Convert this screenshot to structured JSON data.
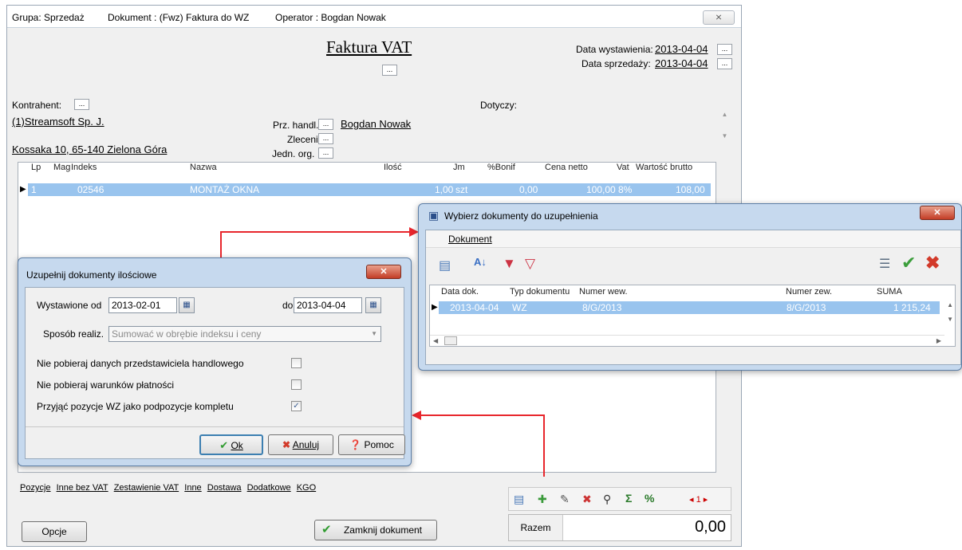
{
  "main": {
    "title_group": "Grupa: Sprzedaż",
    "title_doc": "Dokument : (Fwz) Faktura do WZ",
    "title_operator": "Operator : Bogdan Nowak",
    "close_label": "⨯",
    "heading": "Faktura VAT",
    "dots": "...",
    "data_wyst_label": "Data wystawienia:",
    "data_wyst": "2013-04-04",
    "data_sprz_label": "Data sprzedaży:",
    "data_sprz": "2013-04-04",
    "kontrahent_label": "Kontrahent:",
    "dotyczy_label": "Dotyczy:",
    "kontrahent_name": "(1)Streamsoft Sp. J.",
    "kontrahent_addr": "Kossaka 10, 65-140 Zielona Góra",
    "prz_handl_label": "Prz. handl.",
    "prz_handl_value": "Bogdan Nowak",
    "zlecenie_label": "Zlecenie",
    "jedn_org_label": "Jedn. org.",
    "columns": {
      "lp": "Lp",
      "mag": "Mag",
      "indeks": "Indeks",
      "nazwa": "Nazwa",
      "ilosc": "Ilość",
      "jm": "Jm",
      "bonif": "%Bonif",
      "cena": "Cena netto",
      "vat": "Vat",
      "wartosc": "Wartość brutto"
    },
    "row": {
      "lp": "1",
      "indeks": "02546",
      "nazwa": "MONTAŻ OKNA",
      "ilosc": "1,00",
      "jm": "szt",
      "bonif": "0,00",
      "cena": "100,00",
      "vat": "8%",
      "wartosc": "108,00"
    },
    "tabs": [
      "Pozycje",
      "Inne bez VAT",
      "Zestawienie VAT",
      "Inne",
      "Dostawa",
      "Dodatkowe",
      "KGO"
    ],
    "opcje": "Opcje",
    "zamknij": "Zamknij dokument",
    "razem_label": "Razem",
    "razem_value": "0,00",
    "page_nav": "◂ 1 ▸"
  },
  "dlg_uzup": {
    "title": "Uzupełnij dokumenty ilościowe",
    "close": "✕",
    "wyst_od_label": "Wystawione od",
    "wyst_od": "2013-02-01",
    "do_label": "do",
    "do_value": "2013-04-04",
    "sposob_label": "Sposób realiz.",
    "sposob_value": "Sumować w obrębie indeksu i ceny",
    "opt1": "Nie pobieraj danych przedstawiciela handlowego",
    "opt2": "Nie pobieraj warunków płatności",
    "opt3": "Przyjąć pozycje WZ jako podpozycje kompletu",
    "check_mark": "✓",
    "ok": "Ok",
    "anuluj": "Anuluj",
    "pomoc": "Pomoc"
  },
  "dlg_wybierz": {
    "title": "Wybierz dokumenty do uzupełnienia",
    "close": "✕",
    "menu": "Dokument",
    "columns": {
      "data": "Data dok.",
      "typ": "Typ dokumentu",
      "wew": "Numer wew.",
      "zew": "Numer zew.",
      "suma": "SUMA"
    },
    "row": {
      "data": "2013-04-04",
      "typ": "WZ",
      "wew": "8/G/2013",
      "zew": "8/G/2013",
      "suma": "1 215,24"
    }
  },
  "colors": {
    "selection": "#99c4ee",
    "annotation": "#e8262c",
    "dialog_frame": "#c6d9ee"
  }
}
